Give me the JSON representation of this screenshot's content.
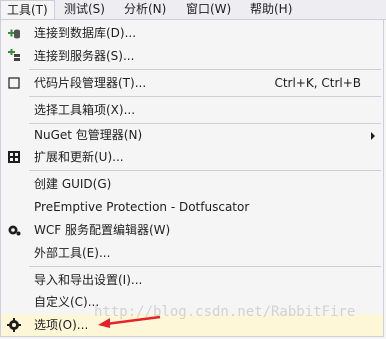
{
  "menubar": {
    "items": [
      {
        "label": "工具(T)"
      },
      {
        "label": "测试(S)"
      },
      {
        "label": "分析(N)"
      },
      {
        "label": "窗口(W)"
      },
      {
        "label": "帮助(H)"
      }
    ]
  },
  "menu": {
    "items": [
      {
        "label": "连接到数据库(D)...",
        "icon": "database-connect-icon"
      },
      {
        "label": "连接到服务器(S)...",
        "icon": "server-connect-icon"
      },
      {
        "label": "代码片段管理器(T)...",
        "shortcut": "Ctrl+K, Ctrl+B",
        "icon": "checkbox-icon"
      },
      {
        "label": "选择工具箱项(X)..."
      },
      {
        "label": "NuGet 包管理器(N)",
        "submenu": true
      },
      {
        "label": "扩展和更新(U)...",
        "icon": "extensions-icon"
      },
      {
        "label": "创建 GUID(G)"
      },
      {
        "label": "PreEmptive Protection - Dotfuscator"
      },
      {
        "label": "WCF 服务配置编辑器(W)",
        "icon": "gear-icon"
      },
      {
        "label": "外部工具(E)..."
      },
      {
        "label": "导入和导出设置(I)..."
      },
      {
        "label": "自定义(C)..."
      },
      {
        "label": "选项(O)...",
        "icon": "gear-icon"
      }
    ]
  },
  "watermark": "http://blog.csdn.net/RabbitFire",
  "colors": {
    "arrow": "#e8202a",
    "separator": "#cccedb",
    "menu_bg": "#f5f5f5"
  }
}
